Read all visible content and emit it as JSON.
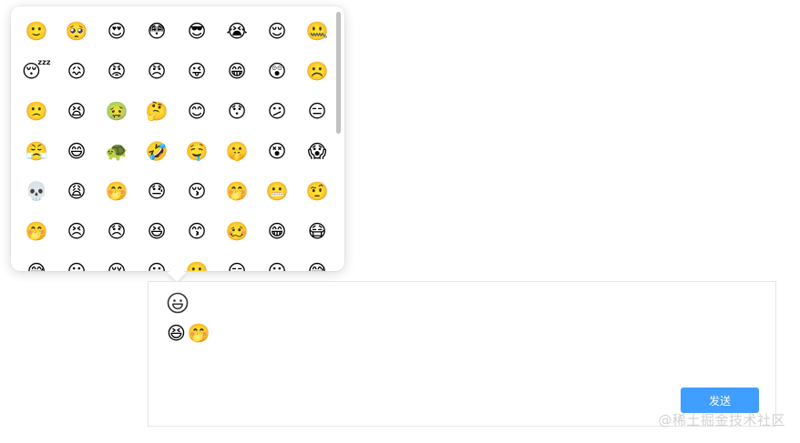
{
  "emoji_picker": {
    "emojis": [
      "🙂",
      "🥺",
      "😍",
      "😳",
      "😎",
      "😭",
      "😌",
      "🤐",
      "😴",
      "😖",
      "😡",
      "😠",
      "😜",
      "😁",
      "😲",
      "☹️",
      "🙁",
      "😫",
      "🤢",
      "🤔",
      "😊",
      "😯",
      "😕",
      "😑",
      "😤",
      "😄",
      "🐢",
      "🤣",
      "🤤",
      "🤫",
      "😵",
      "😱",
      "💀",
      "😩",
      "🤭",
      "😓",
      "😚",
      "🤭",
      "😬",
      "🤨",
      "🤭",
      "😣",
      "😞",
      "😆",
      "😙",
      "🥴",
      "😁",
      "😷",
      "😅",
      "😐",
      "😢",
      "😶",
      "🙂",
      "😏",
      "😐",
      "😅"
    ]
  },
  "editor": {
    "emoji_toggle_icon": "smiley-outline-icon",
    "content": "😆🤭",
    "send_label": "发送"
  },
  "watermark": "@稀土掘金技术社区",
  "colors": {
    "accent": "#409eff",
    "border": "#e4e6eb"
  }
}
